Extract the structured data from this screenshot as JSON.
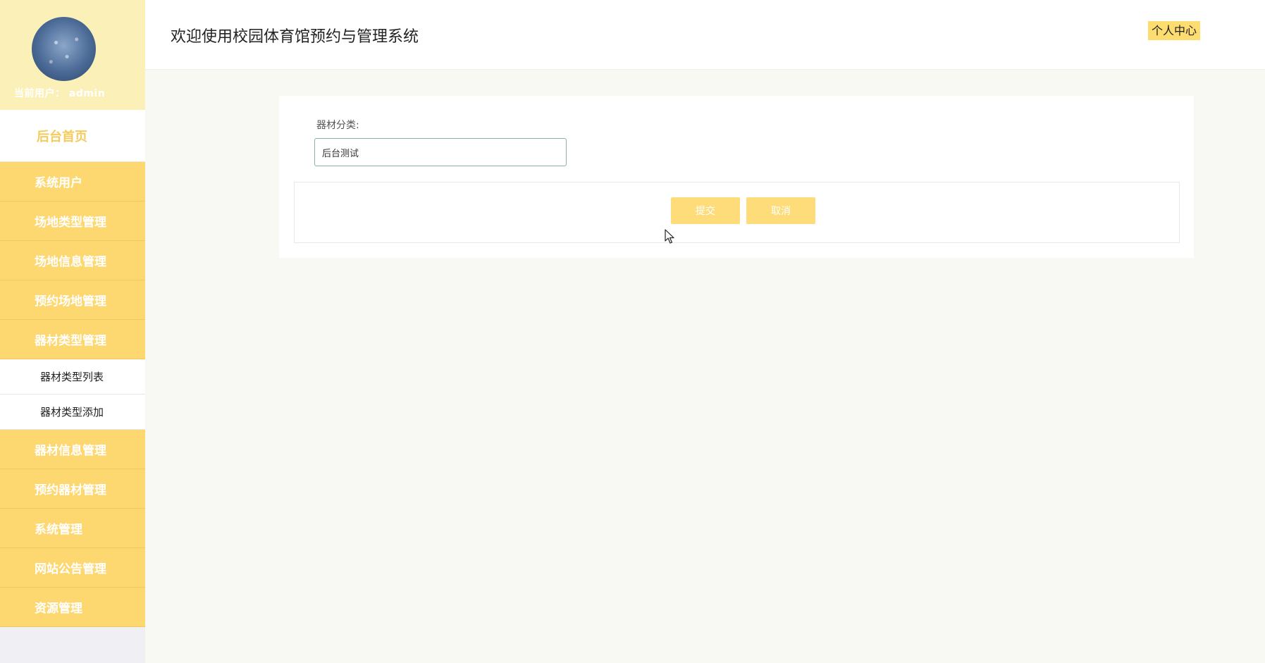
{
  "sidebar": {
    "user_label": "当前用户：",
    "username": "admin",
    "home": "后台首页",
    "menu_before": [
      "系统用户",
      "场地类型管理",
      "场地信息管理",
      "预约场地管理",
      "器材类型管理"
    ],
    "sub_items": [
      "器材类型列表",
      "器材类型添加"
    ],
    "menu_after": [
      "器材信息管理",
      "预约器材管理",
      "系统管理",
      "网站公告管理",
      "资源管理"
    ]
  },
  "header": {
    "title": "欢迎使用校园体育馆预约与管理系统",
    "personal_center": "个人中心"
  },
  "form": {
    "label": "器材分类:",
    "value": "后台测试",
    "submit": "提交",
    "cancel": "取消"
  },
  "colors": {
    "sidebar_menu": "#fdd770",
    "profile_bg": "#fbf1b8",
    "home_text": "#f5cb5b",
    "button": "#fddc79"
  }
}
